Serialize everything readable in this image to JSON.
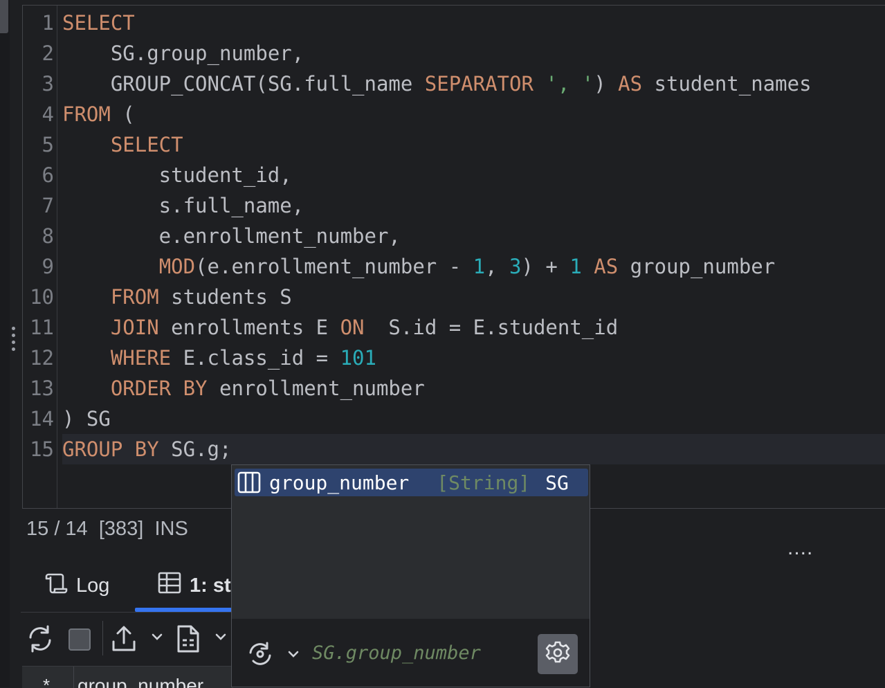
{
  "editor": {
    "line_numbers": [
      "1",
      "2",
      "3",
      "4",
      "5",
      "6",
      "7",
      "8",
      "9",
      "10",
      "11",
      "12",
      "13",
      "14",
      "15"
    ],
    "tokens": {
      "l1_select": "SELECT",
      "l2_indent": "    ",
      "l2_text": "SG.group_number,",
      "l3_indent": "    ",
      "l3_fn": "GROUP_CONCAT",
      "l3_open": "(SG.full_name ",
      "l3_sep": "SEPARATOR",
      "l3_space": " ",
      "l3_str": "', '",
      "l3_close": ") ",
      "l3_as": "AS",
      "l3_alias": " student_names",
      "l4_from": "FROM",
      "l4_rest": " (",
      "l5_indent": "    ",
      "l5_select": "SELECT",
      "l6_text": "        student_id,",
      "l7_text": "        s.full_name,",
      "l8_text": "        e.enrollment_number,",
      "l9_indent": "        ",
      "l9_fn": "MOD",
      "l9_a": "(e.enrollment_number - ",
      "l9_n1": "1",
      "l9_b": ", ",
      "l9_n2": "3",
      "l9_c": ") + ",
      "l9_n3": "1",
      "l9_d": " ",
      "l9_as": "AS",
      "l9_alias": " group_number",
      "l10_indent": "    ",
      "l10_from": "FROM",
      "l10_rest": " students S",
      "l11_indent": "    ",
      "l11_join": "JOIN",
      "l11_mid": " enrollments E ",
      "l11_on": "ON",
      "l11_rest": "  S.id = E.student_id",
      "l12_indent": "    ",
      "l12_where": "WHERE",
      "l12_mid": " E.class_id = ",
      "l12_num": "101",
      "l13_indent": "    ",
      "l13_order": "ORDER BY",
      "l13_rest": " enrollment_number",
      "l14_text": ") SG",
      "l15_group": "GROUP BY",
      "l15_rest": " SG.g;"
    }
  },
  "status": {
    "position": "15 / 14",
    "chars": "[383]",
    "mode": "INS"
  },
  "more_label": "....",
  "tabs": [
    {
      "label": "Log",
      "icon": "scroll-icon"
    },
    {
      "label": "1: st",
      "icon": "table-grid-icon"
    }
  ],
  "grid": {
    "star": "*",
    "column": "group_number"
  },
  "completion": {
    "item": {
      "icon": "column-icon",
      "name": "group_number",
      "type": "[String]",
      "source": "SG"
    },
    "preview": "SG.group_number"
  },
  "colors": {
    "keyword": "#cf8e6d",
    "number": "#2aacb8",
    "string": "#6aab73",
    "selection": "#2e436e",
    "accent": "#3574f0"
  }
}
